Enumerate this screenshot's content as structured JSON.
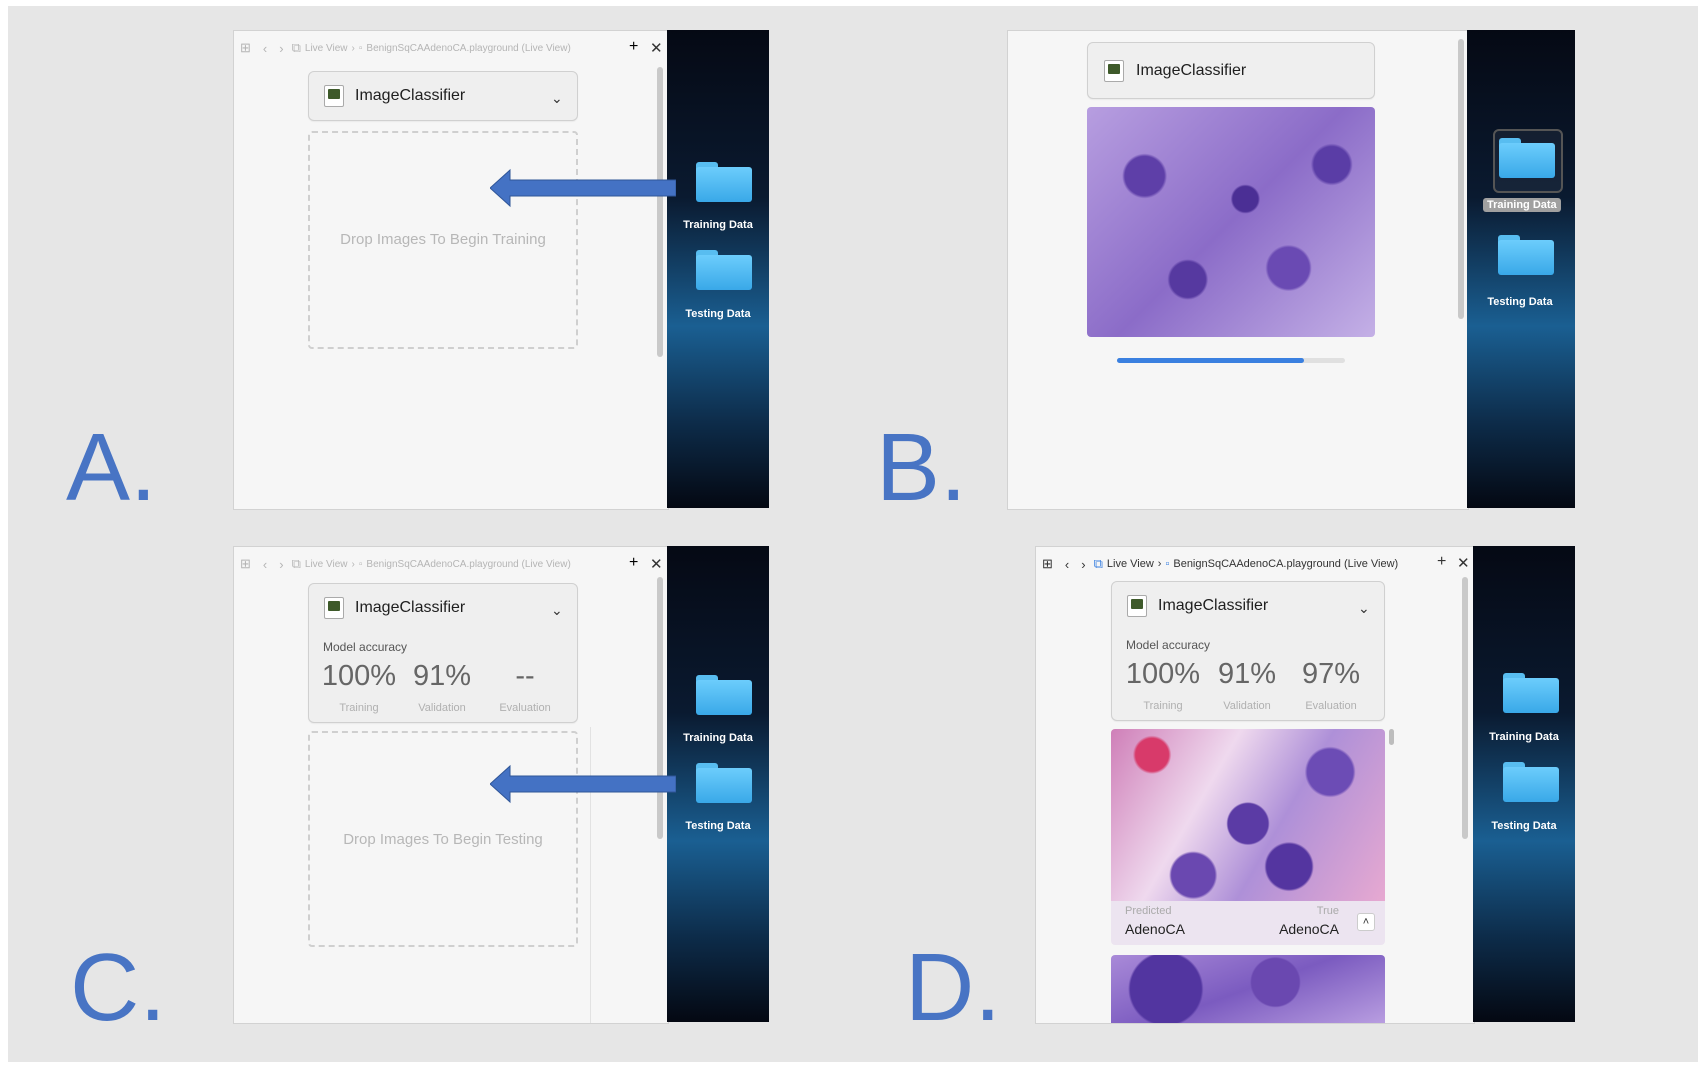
{
  "panels": {
    "a": {
      "label": "A.",
      "toolbar": {
        "path1": "Live View",
        "path2": "BenignSqCAAdenoCA.playground (Live View)"
      },
      "card_title": "ImageClassifier",
      "drop_text": "Drop Images To Begin Training",
      "folders": [
        "Training Data",
        "Testing Data"
      ]
    },
    "b": {
      "label": "B.",
      "card_title": "ImageClassifier",
      "progress": 0.82,
      "folders": [
        "Training Data",
        "Testing Data"
      ]
    },
    "c": {
      "label": "C.",
      "toolbar": {
        "path1": "Live View",
        "path2": "BenignSqCAAdenoCA.playground (Live View)"
      },
      "card_title": "ImageClassifier",
      "model_accuracy": "Model accuracy",
      "metrics": [
        {
          "value": "100%",
          "label": "Training"
        },
        {
          "value": "91%",
          "label": "Validation"
        },
        {
          "value": "--",
          "label": "Evaluation"
        }
      ],
      "drop_text": "Drop Images To Begin Testing",
      "folders": [
        "Training Data",
        "Testing Data"
      ]
    },
    "d": {
      "label": "D.",
      "toolbar": {
        "path1": "Live View",
        "path2": "BenignSqCAAdenoCA.playground (Live View)"
      },
      "card_title": "ImageClassifier",
      "model_accuracy": "Model accuracy",
      "metrics": [
        {
          "value": "100%",
          "label": "Training"
        },
        {
          "value": "91%",
          "label": "Validation"
        },
        {
          "value": "97%",
          "label": "Evaluation"
        }
      ],
      "prediction": {
        "predicted_label": "Predicted",
        "predicted_value": "AdenoCA",
        "true_label": "True",
        "true_value": "AdenoCA"
      },
      "folders": [
        "Training Data",
        "Testing Data"
      ]
    }
  },
  "colors": {
    "label_blue": "#4874c4",
    "arrow_blue": "#4472c4",
    "progress_blue": "#3a80e0",
    "folder_blue": "#58bdf0"
  },
  "icons": [
    "grid-icon",
    "back-icon",
    "forward-icon",
    "live-view-icon",
    "playground-file-icon",
    "plus-icon",
    "close-icon",
    "ml-model-icon",
    "chevron-down-icon",
    "folder-icon",
    "chevron-up-icon"
  ]
}
